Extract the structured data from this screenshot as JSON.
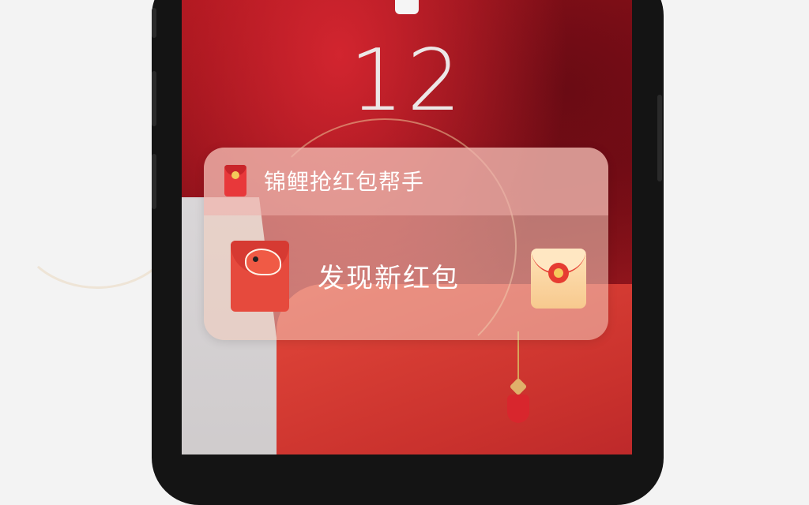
{
  "lockscreen": {
    "time": "12"
  },
  "notification": {
    "app_name": "锦鲤抢红包帮手",
    "message": "发现新红包",
    "app_icon": "red-envelope-icon",
    "envelope_icon": "koi-red-envelope-icon",
    "thumbnail_icon": "gold-red-envelope-icon"
  },
  "colors": {
    "wallpaper_red": "#a5141c",
    "envelope_red": "#e64a3d",
    "banner_tint": "#f4cdbe"
  }
}
